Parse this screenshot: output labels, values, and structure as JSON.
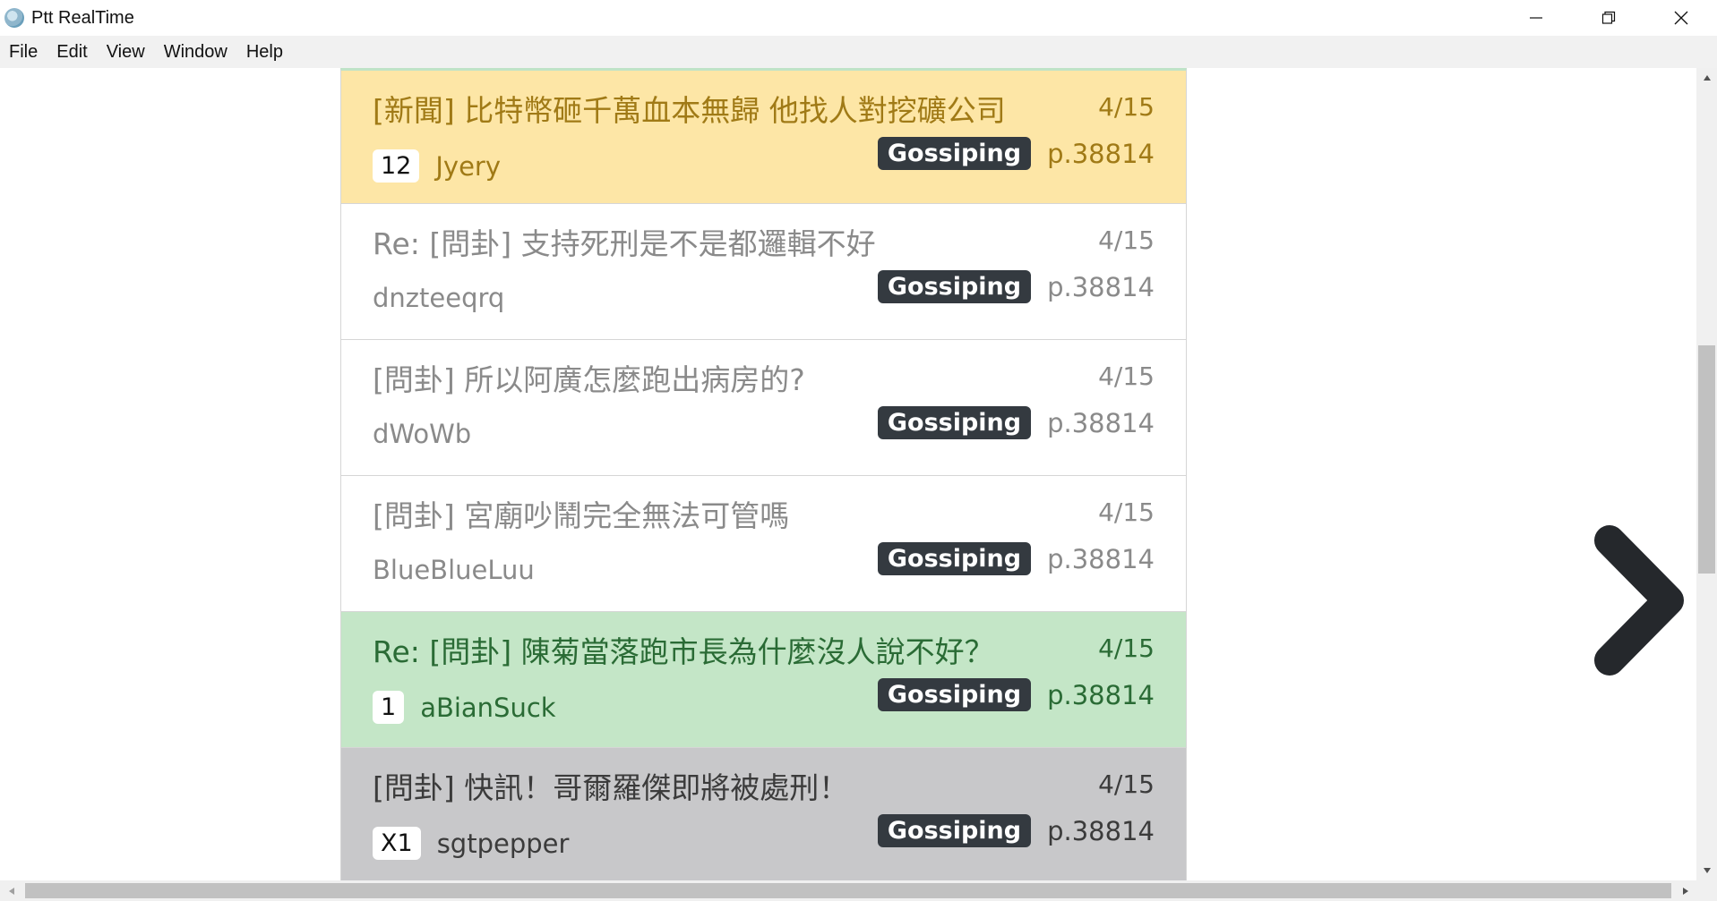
{
  "window": {
    "title": "Ptt RealTime",
    "icon": "app-icon"
  },
  "menu": [
    "File",
    "Edit",
    "View",
    "Window",
    "Help"
  ],
  "posts": [
    {
      "title": "[新聞] 比特幣砸千萬血本無歸 他找人對挖礦公司",
      "date": "4/15",
      "count": "12",
      "author": "Jyery",
      "board": "Gossiping",
      "page": "p.38814",
      "style": "yellow"
    },
    {
      "title": "Re: [問卦] 支持死刑是不是都邏輯不好",
      "date": "4/15",
      "count": "",
      "author": "dnzteeqrq",
      "board": "Gossiping",
      "page": "p.38814",
      "style": "white"
    },
    {
      "title": "[問卦] 所以阿廣怎麼跑出病房的?",
      "date": "4/15",
      "count": "",
      "author": "dWoWb",
      "board": "Gossiping",
      "page": "p.38814",
      "style": "white"
    },
    {
      "title": "[問卦] 宮廟吵鬧完全無法可管嗎",
      "date": "4/15",
      "count": "",
      "author": "BlueBlueLuu",
      "board": "Gossiping",
      "page": "p.38814",
      "style": "white"
    },
    {
      "title": "Re: [問卦] 陳菊當落跑市長為什麼沒人說不好？",
      "date": "4/15",
      "count": "1",
      "author": "aBianSuck",
      "board": "Gossiping",
      "page": "p.38814",
      "style": "green"
    },
    {
      "title": "[問卦] 快訊！哥爾羅傑即將被處刑！",
      "date": "4/15",
      "count": "X1",
      "author": "sgtpepper",
      "board": "Gossiping",
      "page": "p.38814",
      "style": "gray"
    }
  ],
  "colors": {
    "yellow_bg": "#fde6a6",
    "green_bg": "#c4e6c7",
    "gray_bg": "#c8c8ca",
    "badge_bg": "#343a40"
  },
  "icons": {
    "next": "chevron-right-icon"
  }
}
